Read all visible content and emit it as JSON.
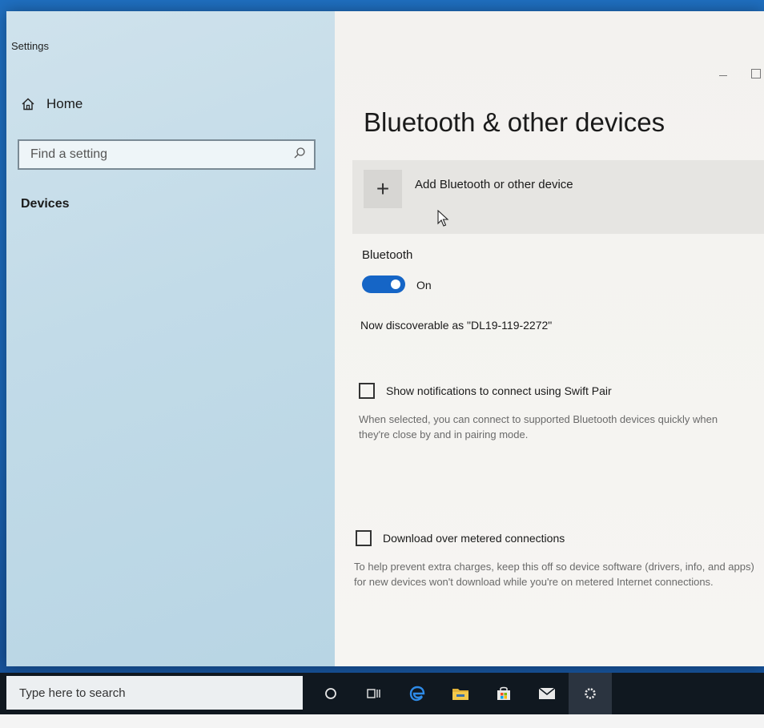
{
  "window": {
    "title": "Settings"
  },
  "sidebar": {
    "home_label": "Home",
    "search_placeholder": "Find a setting",
    "section_label": "Devices"
  },
  "main": {
    "title": "Bluetooth & other devices",
    "add_device_label": "Add Bluetooth or other device",
    "bluetooth_label": "Bluetooth",
    "bluetooth_toggle_state": "On",
    "bluetooth_on": true,
    "discoverable_text": "Now discoverable as \"DL19-119-2272\"",
    "swift_pair": {
      "label": "Show notifications to connect using Swift Pair",
      "checked": false,
      "description": "When selected, you can connect to supported Bluetooth devices quickly when they're close by and in pairing mode."
    },
    "metered": {
      "label": "Download over metered connections",
      "checked": false,
      "description": "To help prevent extra charges, keep this off so device software (drivers, info, and apps) for new devices won't download while you're on metered Internet connections."
    }
  },
  "taskbar": {
    "search_placeholder": "Type here to search",
    "icons": [
      "cortana-icon",
      "task-view-icon",
      "edge-icon",
      "file-explorer-icon",
      "store-icon",
      "mail-icon",
      "settings-icon"
    ]
  },
  "colors": {
    "accent": "#1565c6",
    "sidebar_bg": "#c2dbe8",
    "taskbar_bg": "#101820",
    "desktop_bg": "#1a64b3"
  }
}
